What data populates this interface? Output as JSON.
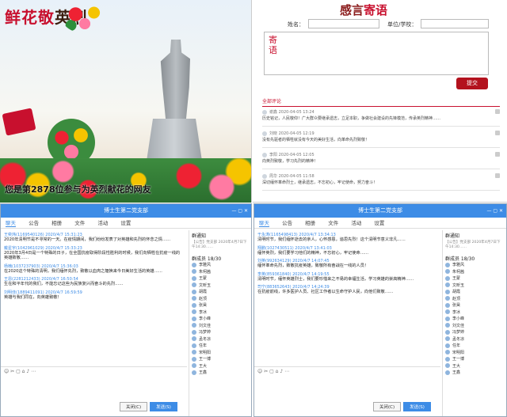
{
  "poster": {
    "title_red": "鲜花敬",
    "title_dark": "英烈",
    "caption": "您是第2878位参与为英烈献花的网友"
  },
  "board": {
    "title_red": "感言",
    "title_dark": "寄语",
    "name_label": "姓名：",
    "unit_label": "单位/学校：",
    "message_label": "寄语",
    "submit_label": "提交",
    "tab_label": "全部评论",
    "comments": [
      {
        "meta": "谢鑫 2020-04-05 13:24",
        "text": "历史铭记，人民敬仰！广大群众要继承遗志，立足本职，争做社会建设的先锋模范，传承英烈精神……"
      },
      {
        "meta": "刘晓 2020-04-05 12:19",
        "text": "没有先驱者的牺牲就没有今天的美好生活，向革命先烈致敬！"
      },
      {
        "meta": "李阳 2020-04-05 12:05",
        "text": "向英烈致敬，学习先烈的精神！"
      },
      {
        "meta": "周华 2020-04-05 11:58",
        "text": "深切缅怀革命烈士，继承遗志，不忘初心，牢记使命，努力奋斗！"
      }
    ]
  },
  "chat_left": {
    "title": "博士生第二党支部",
    "tabs": [
      "聊天",
      "公告",
      "相册",
      "文件",
      "活动",
      "设置"
    ],
    "messages": [
      {
        "who": "王奕炜(1169540126) 2020/4/7 15:31:23",
        "body": "2020年清明节是不寻常的一天。在疫情期间，我们纷纷发表了对英雄和先烈的怀念之情……"
      },
      {
        "who": "戴星宇(1042961029) 2020/4/7 15:33:23",
        "body": "2020年3月4日是一个特殊的日子，在全国抗疫取得阶段性胜利的时候，我们向牺牲在抗疫一线的英雄致敬……"
      },
      {
        "who": "杨楠(1037237903) 2020/4/7 15:36:03",
        "body": "在2020这个特殊的清明，我们缅怀先烈，致敬以血肉之躯换来今日美好生活的英雄……"
      },
      {
        "who": "王恩(2281212433) 2020/4/7 16:50:54",
        "body": "生在和平年代的我们，不能忘记这些为民族复兴而奋斗的先烈……"
      },
      {
        "who": "刘明佳(1889411091) 2020/4/7 16:59:59",
        "body": "英雄与我们同在，向英雄致敬！"
      }
    ],
    "notice_title": "群通知",
    "notice_text": "【公告】党支部 2020年4月7日下午14:30……",
    "members_label": "群成员 18/30",
    "members": [
      "李雅风",
      "朱柯茜",
      "王蒙",
      "文昕玉",
      "胡霞",
      "赵顶",
      "张昊",
      "李冰",
      "李小峰",
      "刘文佳",
      "冯梦婷",
      "孟冬凉",
      "任年",
      "宋明阳",
      "王一博",
      "王大",
      "王鑫"
    ],
    "toolbar": "☺ ✂ ▢ ⌂ ♪ ⋯",
    "close_label": "关闭(C)",
    "send_label": "发送(S)"
  },
  "chat_right": {
    "title": "博士生第二党支部",
    "tabs": [
      "聊天",
      "公告",
      "相册",
      "文件",
      "活动",
      "设置"
    ],
    "messages": [
      {
        "who": "于永涛(1165498413) 2020/4/7 13:34:13",
        "body": "清明时节，我们缅怀逝去的亲人，心怀感恩，追思先烈！这个清明节意义非凡……"
      },
      {
        "who": "翔鹏(1027430511) 2020/4/7 13:41:03",
        "body": "缅怀英烈，我们要学习他们的精神，不忘初心，牢记使命……"
      },
      {
        "who": "刘英(992634129) 2020/4/7 14:07:45",
        "body": "缅怀革命先烈，致敬抗疫英雄，致敬所有奋战在一线的人员！"
      },
      {
        "who": "李英(859361840) 2020/4/7 14:19:55",
        "body": "清明时节，缅怀英雄烈士，我们要珍惜来之不易的幸福生活，学习英雄的崇高精神……"
      },
      {
        "who": "司宁(883652643) 2020/4/7 14:24:39",
        "body": "在抗疫前线，许多医护人员、社区工作者以生命守护人民，向他们致敬……"
      }
    ],
    "notice_title": "群通知",
    "notice_text": "【公告】党支部 2020年4月7日下午14:30……",
    "members_label": "群成员 18/30",
    "members": [
      "李雅风",
      "朱柯茜",
      "王蒙",
      "文昕玉",
      "胡霞",
      "赵顶",
      "张昊",
      "李冰",
      "李小峰",
      "刘文佳",
      "冯梦婷",
      "孟冬凉",
      "任年",
      "宋明阳",
      "王一博",
      "王大",
      "王鑫"
    ],
    "toolbar": "☺ ✂ ▢ ⌂ ♪ ⋯",
    "close_label": "关闭(C)",
    "send_label": "发送(S)"
  }
}
